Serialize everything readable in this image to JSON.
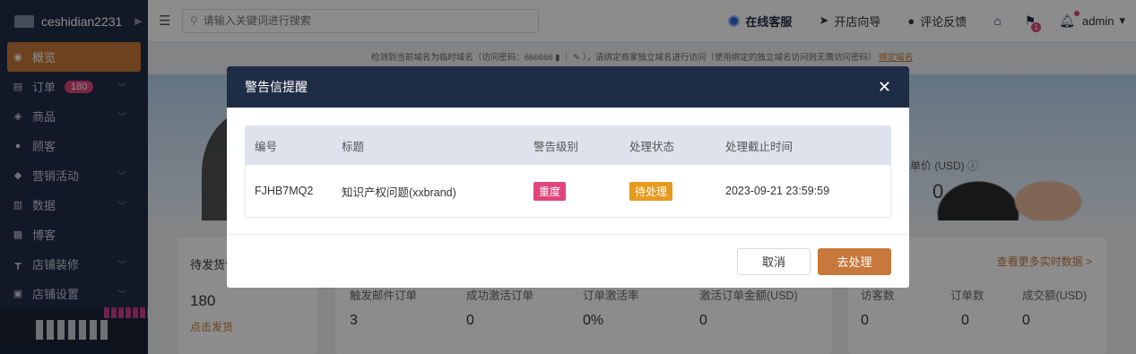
{
  "sidebar": {
    "brand": "ceshidian2231",
    "items": [
      {
        "label": "概览",
        "icon": "dashboard-icon",
        "glyph": "◉"
      },
      {
        "label": "订单",
        "icon": "order-icon",
        "glyph": "▤",
        "badge": "180",
        "chevron": true
      },
      {
        "label": "商品",
        "icon": "product-icon",
        "glyph": "◈",
        "chevron": true
      },
      {
        "label": "顾客",
        "icon": "customer-icon",
        "glyph": "●"
      },
      {
        "label": "营销活动",
        "icon": "tag-icon",
        "glyph": "◆",
        "chevron": true
      },
      {
        "label": "数据",
        "icon": "chart-icon",
        "glyph": "▥",
        "chevron": true
      },
      {
        "label": "博客",
        "icon": "blog-icon",
        "glyph": "▦"
      },
      {
        "label": "店铺装修",
        "icon": "brush-icon",
        "glyph": "┳",
        "chevron": true
      },
      {
        "label": "店铺设置",
        "icon": "store-settings-icon",
        "glyph": "▣",
        "chevron": true
      }
    ]
  },
  "topbar": {
    "search_placeholder": "请输入关键词进行搜索",
    "service": "在线客服",
    "guide": "开店向导",
    "feedback": "评论反馈",
    "notif_count": "1",
    "user": "admin"
  },
  "notice": {
    "text": "检测到当前域名为临时域名（访问密码：666666 ▮ ｜ ✎ ），请绑定商家独立域名进行访问（使用绑定的独立域名访问则无需访问密码）",
    "link": "绑定域名"
  },
  "banner": {
    "price_label": "单价 (USD) ⓘ",
    "price_value": "0"
  },
  "stats": {
    "pending_label": "待发货订",
    "pending_value": "180",
    "pending_link": "点击发货",
    "card2": [
      {
        "label": "触发邮件订单",
        "value": "3"
      },
      {
        "label": "成功激活订单",
        "value": "0"
      },
      {
        "label": "订单激活率",
        "value": "0%"
      },
      {
        "label": "激活订单金额(USD)",
        "value": "0"
      }
    ],
    "card3_more": "查看更多实时数据 >",
    "card3": [
      {
        "label": "访客数",
        "value": "0"
      },
      {
        "label": "订单数",
        "value": "0"
      },
      {
        "label": "成交额(USD)",
        "value": "0"
      }
    ]
  },
  "modal": {
    "title": "警告信提醒",
    "columns": [
      "编号",
      "标题",
      "警告级别",
      "处理状态",
      "处理截止时间"
    ],
    "rows": [
      {
        "id": "FJHB7MQ2",
        "title": "知识产权问题(xxbrand)",
        "level": "重度",
        "status": "待处理",
        "deadline": "2023-09-21 23:59:59"
      }
    ],
    "cancel": "取消",
    "confirm": "去处理"
  },
  "colors": {
    "accent": "#c7783a",
    "sidebar_bg": "#1f2c45",
    "level_red": "#e0457b",
    "status_orange": "#e79a1e"
  }
}
